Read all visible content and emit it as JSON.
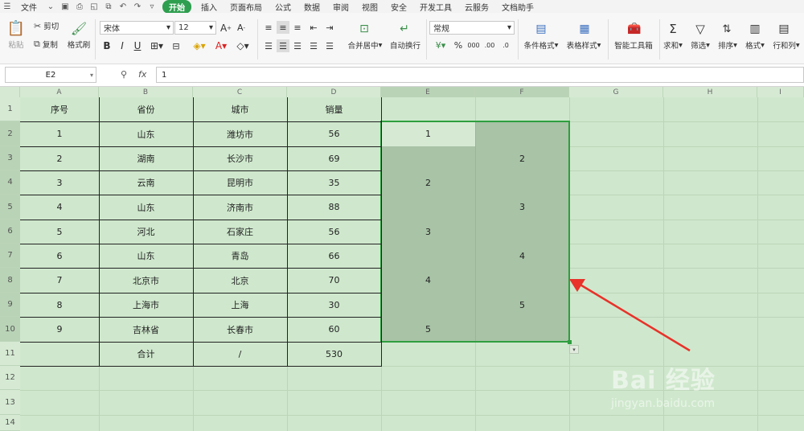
{
  "menubar": {
    "file": "文件",
    "tabs": [
      "开始",
      "插入",
      "页面布局",
      "公式",
      "数据",
      "审阅",
      "视图",
      "安全",
      "开发工具",
      "云服务",
      "文档助手"
    ],
    "active": "开始"
  },
  "ribbon": {
    "paste": "粘贴",
    "cut": "剪切",
    "copy": "复制",
    "format_painter": "格式刷",
    "font_name": "宋体",
    "font_size": "12",
    "merge_center": "合并居中",
    "auto_wrap": "自动换行",
    "number_format": "常规",
    "conditional_format": "条件格式",
    "table_style": "表格样式",
    "smart_toolbox": "智能工具箱",
    "sum": "求和",
    "filter": "筛选",
    "sort": "排序",
    "format": "格式",
    "row_col": "行和列"
  },
  "formula_bar": {
    "name_box": "E2",
    "fx": "fx",
    "value": "1"
  },
  "columns": [
    "A",
    "B",
    "C",
    "D",
    "E",
    "F",
    "G",
    "H",
    "I"
  ],
  "rows": [
    "1",
    "2",
    "3",
    "4",
    "5",
    "6",
    "7",
    "8",
    "9",
    "10",
    "11",
    "12",
    "13",
    "14"
  ],
  "table": {
    "header": [
      "序号",
      "省份",
      "城市",
      "销量"
    ],
    "rows": [
      [
        "1",
        "山东",
        "潍坊市",
        "56"
      ],
      [
        "2",
        "湖南",
        "长沙市",
        "69"
      ],
      [
        "3",
        "云南",
        "昆明市",
        "35"
      ],
      [
        "4",
        "山东",
        "济南市",
        "88"
      ],
      [
        "5",
        "河北",
        "石家庄",
        "56"
      ],
      [
        "6",
        "山东",
        "青岛",
        "66"
      ],
      [
        "7",
        "北京市",
        "北京",
        "70"
      ],
      [
        "8",
        "上海市",
        "上海",
        "30"
      ],
      [
        "9",
        "吉林省",
        "长春市",
        "60"
      ]
    ],
    "total": [
      "",
      "合计",
      "/",
      "530"
    ]
  },
  "selection": {
    "E": [
      "1",
      "",
      "2",
      "",
      "3",
      "",
      "4",
      "",
      "5"
    ],
    "F": [
      "",
      "2",
      "",
      "3",
      "",
      "4",
      "",
      "5",
      ""
    ]
  },
  "colors": {
    "sheet_bg": "#cfe8cd",
    "selection_bg": "#a8c3a6",
    "active_cell": "#d6ead3",
    "selection_border": "#2e9e3f",
    "arrow": "#e8322a",
    "accent": "#2e9e4f"
  },
  "watermark": {
    "brand": "Bai 经验",
    "url": "jingyan.baidu.com"
  }
}
